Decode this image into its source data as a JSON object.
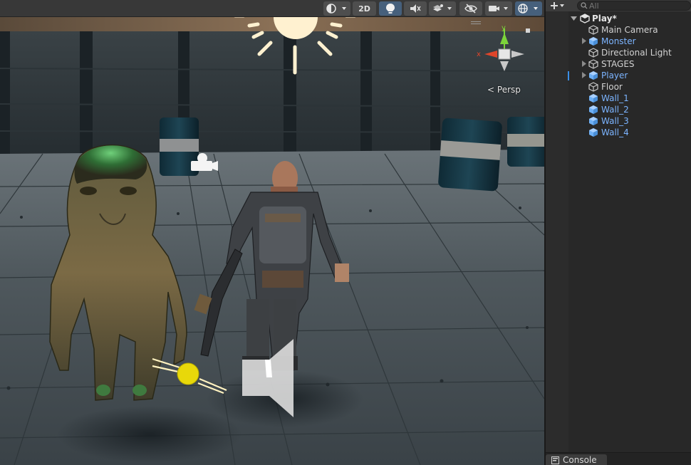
{
  "scene_view": {
    "toolbar": {
      "mode_2d_label": "2D"
    },
    "gizmo": {
      "x_axis_label": "x",
      "y_axis_label": "y",
      "projection_label": "Persp"
    }
  },
  "hierarchy": {
    "search_placeholder": "All",
    "scene_name": "Play*",
    "items": [
      {
        "label": "Main Camera",
        "prefab": false,
        "has_children": false
      },
      {
        "label": "Monster",
        "prefab": true,
        "has_children": true
      },
      {
        "label": "Directional Light",
        "prefab": false,
        "has_children": false
      },
      {
        "label": "STAGES",
        "prefab": false,
        "has_children": true
      },
      {
        "label": "Player",
        "prefab": true,
        "has_children": true
      },
      {
        "label": "Floor",
        "prefab": false,
        "has_children": false
      },
      {
        "label": "Wall_1",
        "prefab": true,
        "has_children": false
      },
      {
        "label": "Wall_2",
        "prefab": true,
        "has_children": false
      },
      {
        "label": "Wall_3",
        "prefab": true,
        "has_children": false
      },
      {
        "label": "Wall_4",
        "prefab": true,
        "has_children": false
      }
    ]
  },
  "bottom_bar": {
    "console_tab_label": "Console"
  },
  "colors": {
    "prefab_text": "#7cb4ff",
    "selection_marker": "#3a8ee6",
    "gizmo_x": "#e0452a",
    "gizmo_y": "#7cd33a"
  }
}
